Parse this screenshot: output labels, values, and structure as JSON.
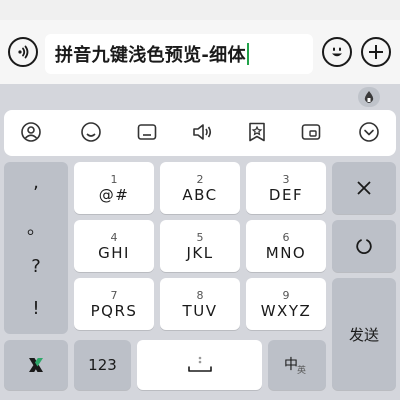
{
  "input": {
    "text": "拼音九键浅色预览-细体"
  },
  "toolbar": {
    "icons": [
      "user-circle-icon",
      "smiley-icon",
      "keyboard-rect-icon",
      "speaker-icon",
      "star-bookmark-icon",
      "card-icon",
      "chevron-down-circle-icon"
    ]
  },
  "punctuation": [
    ",",
    "。",
    "?",
    "!"
  ],
  "keys": [
    {
      "num": "1",
      "letters": "@#"
    },
    {
      "num": "2",
      "letters": "ABC"
    },
    {
      "num": "3",
      "letters": "DEF"
    },
    {
      "num": "4",
      "letters": "GHI"
    },
    {
      "num": "5",
      "letters": "JKL"
    },
    {
      "num": "6",
      "letters": "MNO"
    },
    {
      "num": "7",
      "letters": "PQRS"
    },
    {
      "num": "8",
      "letters": "TUV"
    },
    {
      "num": "9",
      "letters": "WXYZ"
    }
  ],
  "bottom": {
    "numbers_label": "123",
    "lang_main": "中",
    "lang_sub": "英",
    "send_label": "发送"
  },
  "colors": {
    "caret": "#22a34a",
    "keyboard_bg": "#d4d6dc",
    "key_gray": "#bcc0c8",
    "key_white": "#ffffff"
  }
}
